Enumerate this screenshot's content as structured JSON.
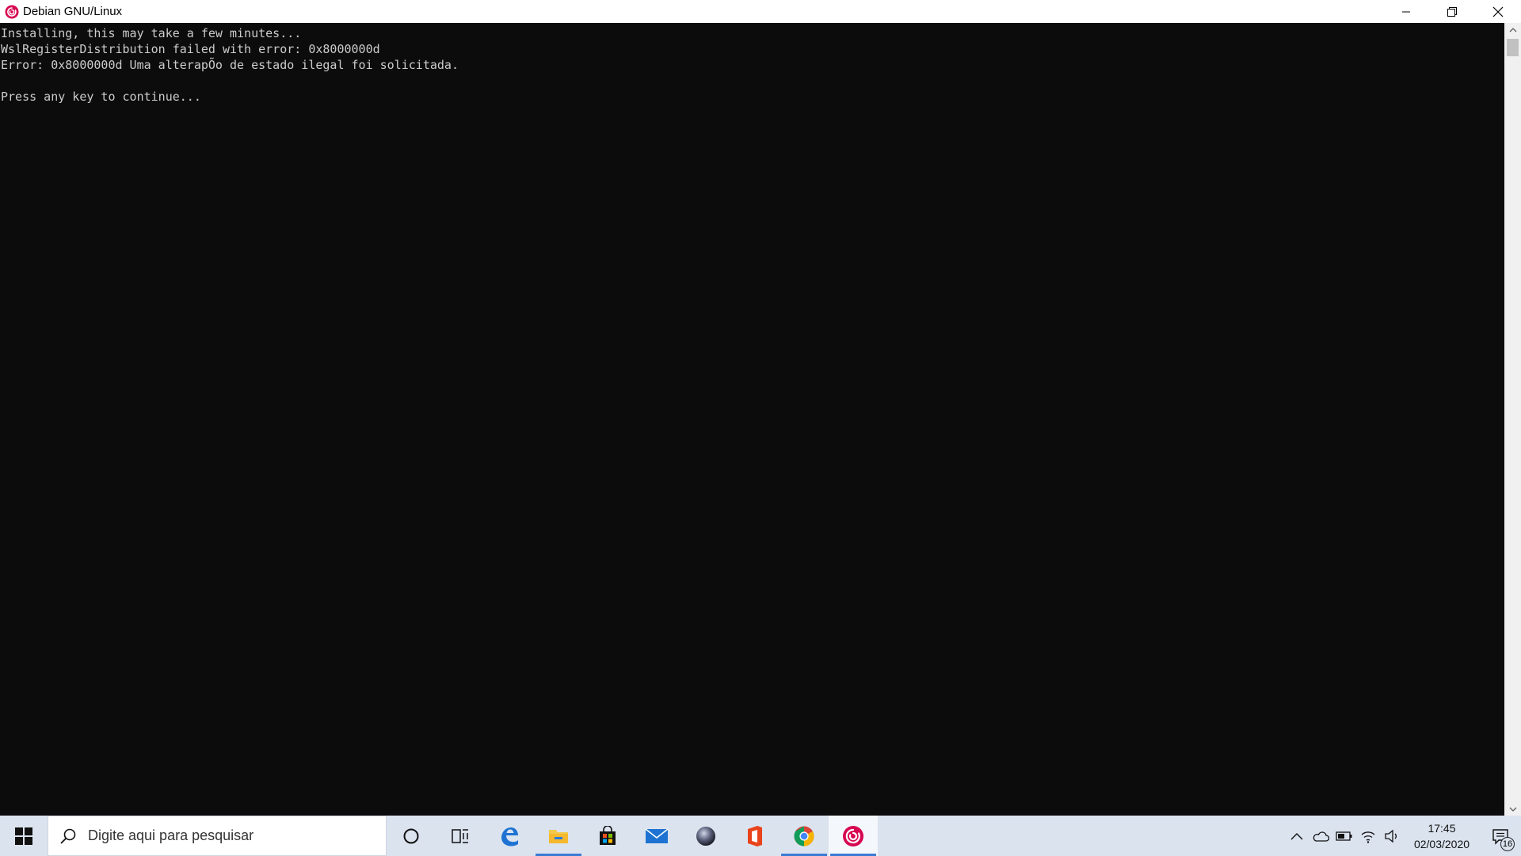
{
  "window": {
    "title": "Debian GNU/Linux",
    "icon": "debian-swirl-icon"
  },
  "console": {
    "lines": [
      "Installing, this may take a few minutes...",
      "WslRegisterDistribution failed with error: 0x8000000d",
      "Error: 0x8000000d Uma alterapÕo de estado ilegal foi solicitada.",
      "",
      "Press any key to continue..."
    ]
  },
  "taskbar": {
    "search_placeholder": "Digite aqui para pesquisar",
    "apps": [
      {
        "name": "cortana-icon"
      },
      {
        "name": "task-view-icon"
      },
      {
        "name": "edge-icon"
      },
      {
        "name": "file-explorer-icon",
        "active": true
      },
      {
        "name": "store-icon"
      },
      {
        "name": "mail-icon"
      },
      {
        "name": "app-sphere-icon"
      },
      {
        "name": "office-icon"
      },
      {
        "name": "chrome-icon",
        "active": true
      },
      {
        "name": "debian-icon",
        "active": true,
        "focused": true
      }
    ],
    "clock": {
      "time": "17:45",
      "date": "02/03/2020"
    },
    "notifications_count": "16"
  },
  "colors": {
    "console_bg": "#0c0c0c",
    "console_fg": "#cccccc",
    "taskbar_bg": "#dbe3ef",
    "debian_red": "#d70751",
    "active_indicator": "#3a7bd5"
  }
}
